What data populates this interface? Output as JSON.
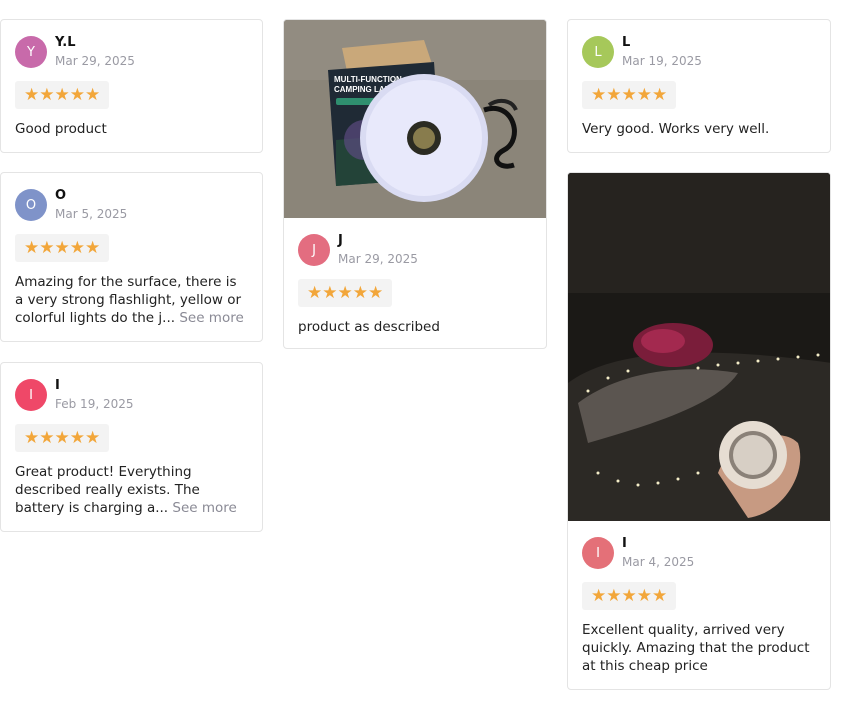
{
  "colors": {
    "star": "#f2a63a",
    "avatar_pink": "#c86aaa",
    "avatar_blue": "#7f93c9",
    "avatar_red": "#ef4868",
    "avatar_rose": "#e36d80",
    "avatar_green": "#a6c85a",
    "avatar_coral": "#e47078"
  },
  "stars_glyph": "★★★★★",
  "reviews": [
    {
      "initial": "Y",
      "name": "Y.L",
      "date": "Mar 29, 2025",
      "rating": 5,
      "text": "Good product"
    },
    {
      "initial": "O",
      "name": "O",
      "date": "Mar 5, 2025",
      "rating": 5,
      "text": "Amazing for the surface, there is a very strong flashlight, yellow or colorful lights do the j...",
      "more": "See more"
    },
    {
      "initial": "I",
      "name": "I",
      "date": "Feb 19, 2025",
      "rating": 5,
      "text": "Great product! Everything described really exists. The battery is charging a...",
      "more": "See more"
    },
    {
      "initial": "J",
      "name": "J",
      "date": "Mar 29, 2025",
      "rating": 5,
      "text": "product as described",
      "photo": {
        "box_line1": "MULTI-FUNCTION",
        "box_line2": "CAMPING LAMP"
      }
    },
    {
      "initial": "L",
      "name": "L",
      "date": "Mar 19, 2025",
      "rating": 5,
      "text": "Very good. Works very well."
    },
    {
      "initial": "I",
      "name": "I",
      "date": "Mar 4, 2025",
      "rating": 5,
      "text": "Excellent quality, arrived very quickly. Amazing that the product at this cheap price"
    }
  ]
}
